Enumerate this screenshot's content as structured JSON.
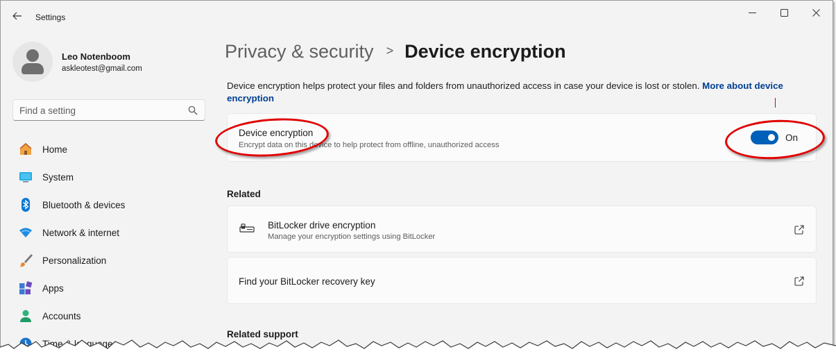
{
  "window": {
    "title": "Settings",
    "back_icon": "arrow-left-icon",
    "controls": [
      "minimize-icon",
      "maximize-icon",
      "close-icon"
    ]
  },
  "profile": {
    "name": "Leo Notenboom",
    "email": "askleotest@gmail.com"
  },
  "search": {
    "placeholder": "Find a setting",
    "icon": "search-icon"
  },
  "sidebar": {
    "items": [
      {
        "label": "Home",
        "icon": "home-icon"
      },
      {
        "label": "System",
        "icon": "system-monitor-icon"
      },
      {
        "label": "Bluetooth & devices",
        "icon": "bluetooth-icon"
      },
      {
        "label": "Network & internet",
        "icon": "wifi-icon"
      },
      {
        "label": "Personalization",
        "icon": "paintbrush-icon"
      },
      {
        "label": "Apps",
        "icon": "apps-icon"
      },
      {
        "label": "Accounts",
        "icon": "accounts-icon"
      },
      {
        "label": "Time & language",
        "icon": "clock-globe-icon"
      }
    ]
  },
  "header": {
    "parent": "Privacy & security",
    "separator": ">",
    "current": "Device encryption"
  },
  "description": {
    "text": "Device encryption helps protect your files and folders from unauthorized access in case your device is lost or stolen. ",
    "link": "More about device encryption"
  },
  "encryption_card": {
    "title": "Device encryption",
    "subtitle": "Encrypt data on this device to help protect from offline, unauthorized access",
    "toggle_state": "On",
    "toggle_on": true
  },
  "related": {
    "heading": "Related",
    "items": [
      {
        "title": "BitLocker drive encryption",
        "subtitle": "Manage your encryption settings using BitLocker",
        "icon": "bitlocker-key-icon",
        "action_icon": "open-external-icon"
      },
      {
        "title": "Find your BitLocker recovery key",
        "action_icon": "open-external-icon"
      }
    ]
  },
  "related_support": {
    "heading": "Related support"
  },
  "colors": {
    "accent": "#005fb8",
    "link": "#003e92",
    "annotation": "#e00000",
    "background": "#f3f3f3",
    "card": "#fbfbfb"
  }
}
